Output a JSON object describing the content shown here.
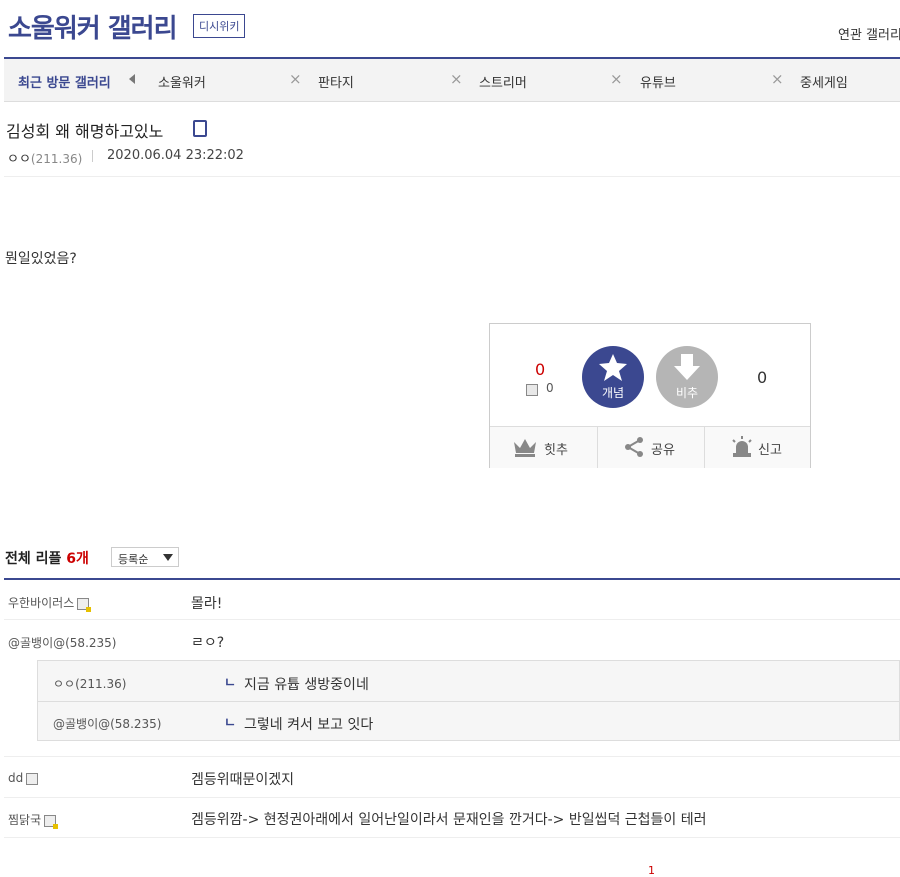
{
  "header": {
    "gallery_title": "소울워커 갤러리",
    "wiki_badge": "디시위키",
    "related_label": "연관 갤러리"
  },
  "recent_nav": {
    "label": "최근 방문 갤러리",
    "items": [
      "소울워커",
      "판타지",
      "스트리머",
      "유튜브",
      "중세게임"
    ]
  },
  "post": {
    "title": "김성회 왜 해명하고있노",
    "author": "ㅇㅇ",
    "author_ip": "(211.36)",
    "date": "2020.06.04 23:22:02",
    "body": "뭔일있었음?"
  },
  "vote": {
    "up_count": "0",
    "fix_count": "0",
    "up_label": "개념",
    "down_label": "비추",
    "down_count": "0",
    "actions": [
      "힛추",
      "공유",
      "신고"
    ]
  },
  "comments": {
    "label": "전체 리플",
    "count": "6개",
    "sort": "등록순",
    "items": [
      {
        "nick": "우한바이러스",
        "text": "몰라!"
      },
      {
        "nick": "@골뱅이@(58.235)",
        "text": "ㄹㅇ?"
      },
      {
        "nick": "dd",
        "text": "겜등위때문이겠지"
      },
      {
        "nick": "찜닭국",
        "text": "겜등위깜-> 현정권아래에서 일어난일이라서 문재인을 깐거다-> 반일씹덕 근첩들이 테러"
      }
    ],
    "replies": [
      {
        "nick": "ㅇㅇ(211.36)",
        "mark": "ㄴ",
        "text": "지금 유튭 생방중이네"
      },
      {
        "nick": "@골뱅이@(58.235)",
        "mark": "ㄴ",
        "text": "그렇네 켜서 보고 잇다"
      }
    ]
  },
  "pagination": {
    "current": "1"
  }
}
